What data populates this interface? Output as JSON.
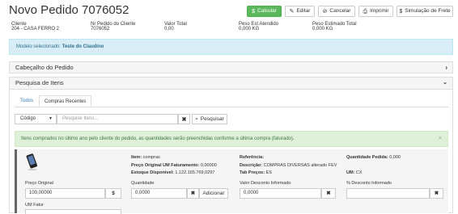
{
  "header": {
    "title": "Novo Pedido 7076052",
    "buttons": {
      "calcular": "Calcular",
      "editar": "Editar",
      "cancelar": "Cancelar",
      "imprimir": "Imprimir",
      "simulacao": "Simulação de Frete"
    },
    "icons": {
      "calcular": "dollar-icon",
      "editar": "pencil-icon",
      "cancelar": "ban-icon",
      "imprimir": "print-icon",
      "simulacao": "dollar-icon"
    }
  },
  "info": {
    "cliente_label": "Cliente",
    "cliente_value": "204 - CASA FERRO 2",
    "nr_pedido_label": "Nr Pedido do Cliente",
    "nr_pedido_value": "7076052",
    "valor_total_label": "Valor Total",
    "valor_total_value": "0,00",
    "peso_est_label": "Peso Est Atendido",
    "peso_est_value": "0,000 KG",
    "peso_estimado_label": "Peso Estimado Total",
    "peso_estimado_value": "0,000 KG"
  },
  "model_alert": {
    "prefix": "Modelo selecionado: ",
    "value": "Teste do Claudino"
  },
  "panels": {
    "cabecalho": "Cabeçalho do Pedido",
    "pesquisa": "Pesquisa de Itens"
  },
  "tabs": {
    "todos": "Todos",
    "compras": "Compras Recentes"
  },
  "search": {
    "select_value": "Código",
    "placeholder": "Pesquise Itens...",
    "button": "Pesquisar"
  },
  "green_alert": {
    "text": "Itens comprados no último ano pelo cliente do pedido, as quantidades serão preenchidas conforme a última compra (faturado).",
    "close": "×"
  },
  "product": {
    "item_label": "Item:",
    "item_value": "compras",
    "preco_um_label": "Preço Original UM Faturamento:",
    "preco_um_value": "0,00000",
    "estoque_label": "Estoque Disponível:",
    "estoque_value": "1.122.165.769,0297",
    "referencia_label": "Referência:",
    "referencia_value": "",
    "descricao_label": "Descrição:",
    "descricao_value": "COMPRAS DIVERSAS alterado FEV",
    "tab_precos_label": "Tab Preços:",
    "tab_precos_value": "ES",
    "qtd_pedida_label": "Quantidade Pedida:",
    "qtd_pedida_value": "0,000",
    "um_label": "UM:",
    "um_value": "CX",
    "preco_original_label": "Preço Original",
    "preco_original_value": "100,00000",
    "quantidade_label": "Quantidade",
    "quantidade_value": "0,0000",
    "adicionar": "Adicionar",
    "valor_desconto_label": "Valor Desconto Informado",
    "valor_desconto_value": "0,0000",
    "pct_desconto_label": "% Desconto Informado",
    "pct_desconto_value": "",
    "um_fatur_label": "UM Fatur",
    "dollar_symbol": "$",
    "clear_symbol": "✖"
  },
  "colors": {
    "success": "#5cb85c",
    "info_bg": "#d9edf7",
    "info_text": "#31708f",
    "success_bg": "#dff0d8",
    "success_text": "#3c763d",
    "link": "#337ab7"
  }
}
